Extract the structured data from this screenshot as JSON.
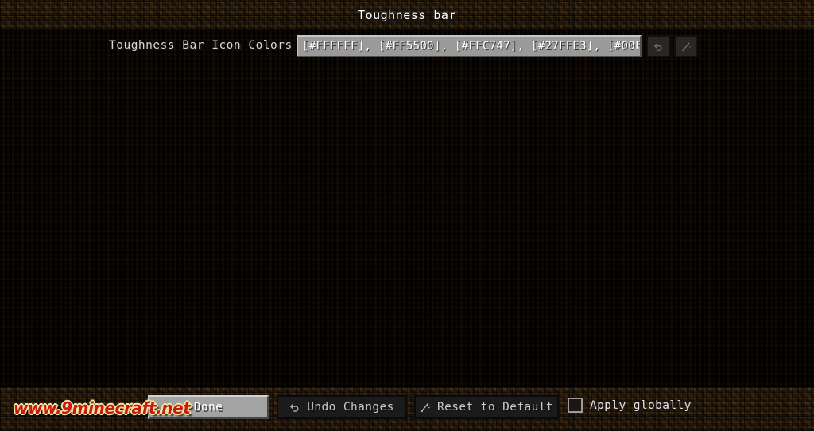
{
  "window": {
    "title": "Toughness bar"
  },
  "entry": {
    "label": "Toughness Bar Icon Colors",
    "field_value": "[#FFFFFF], [#FF5500], [#FFC747], [#27FFE3], [#00F…",
    "field_placeholder": "",
    "undo_icon": "undo-arrow-icon",
    "reset_icon": "magic-wand-icon"
  },
  "footer": {
    "done_label": "Done",
    "undo_changes_label": "Undo Changes",
    "undo_changes_icon": "undo-arrow-icon",
    "reset_default_label": "Reset to Default",
    "reset_default_icon": "magic-wand-icon",
    "apply_globally_label": "Apply globally",
    "apply_globally_checked": "false"
  },
  "watermark": {
    "text": "www.9minecraft.net"
  },
  "colors": {
    "title_text": "#FFFFFF",
    "label_text": "#D8D8D8",
    "field_background": "#9A9A9A",
    "field_text": "#FFFFFF",
    "button_light": "#A3A3A3",
    "button_dark": "#1B1B1B",
    "dirt": "#4A3419",
    "content_background": "#0E0803",
    "watermark_text": "#C81919"
  }
}
